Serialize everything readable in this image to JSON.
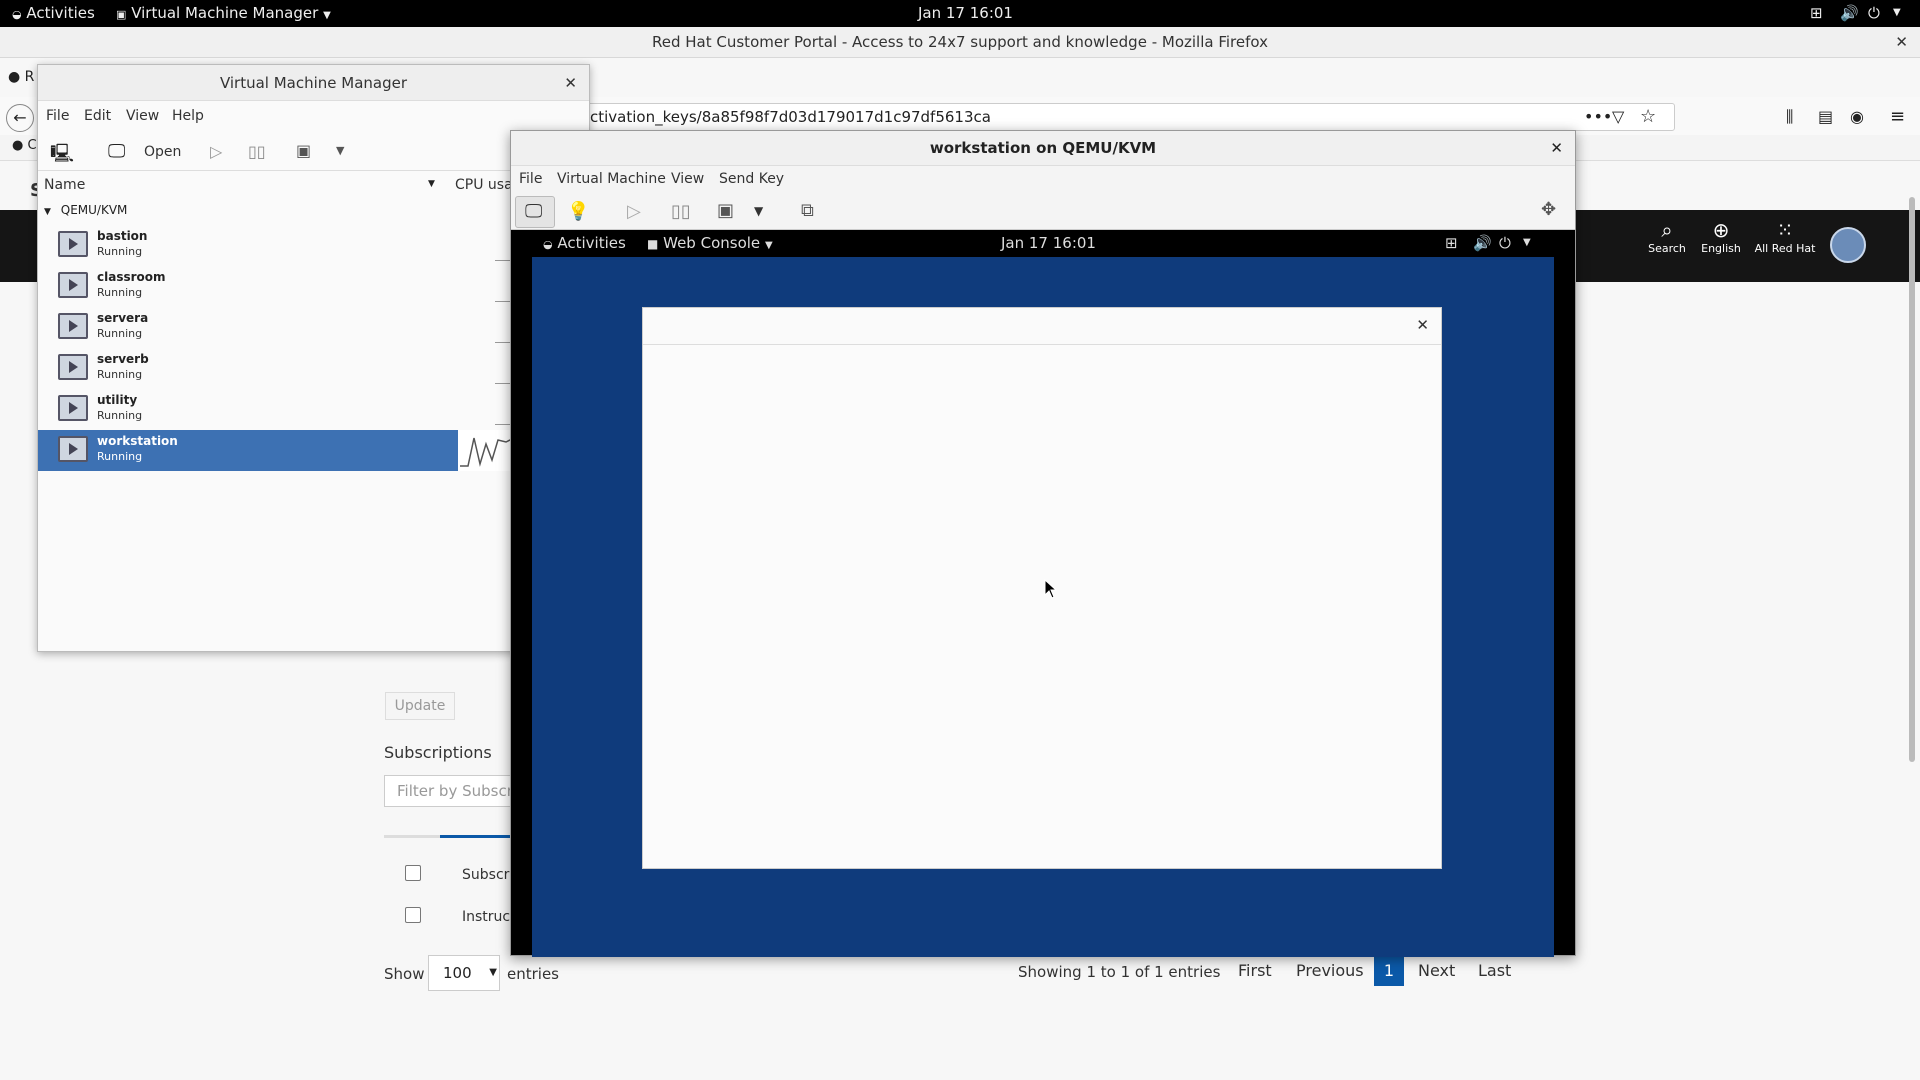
{
  "topbar": {
    "activities": "Activities",
    "app_menu": "Virtual Machine Manager",
    "clock": "Jan 17  16:01"
  },
  "firefox": {
    "title": "Red Hat Customer Portal - Access to 24x7 support and knowledge - Mozilla Firefox",
    "url": "ctivation_keys/8a85f98f7d03d179017d1c97df5613ca",
    "tab_stub": "R",
    "bookmark_stub": "C",
    "header": {
      "search": "Search",
      "language": "English",
      "all_red_hat": "All Red Hat"
    },
    "page": {
      "heading_stub": "S",
      "update_button": "Update",
      "subscriptions_heading": "Subscriptions",
      "filter_placeholder": "Filter by Subscri",
      "rows": [
        "Subscri",
        "Instruct"
      ],
      "show_label": "Show",
      "page_size": "100",
      "entries_label": "entries",
      "showing_text": "Showing 1 to 1 of 1 entries",
      "pagination": {
        "first": "First",
        "previous": "Previous",
        "current": "1",
        "next": "Next",
        "last": "Last"
      }
    }
  },
  "vmm": {
    "title": "Virtual Machine Manager",
    "menu": [
      "File",
      "Edit",
      "View",
      "Help"
    ],
    "toolbar": {
      "open": "Open"
    },
    "columns": {
      "name": "Name",
      "cpu": "CPU usa"
    },
    "connection": "QEMU/KVM",
    "vms": [
      {
        "name": "bastion",
        "status": "Running"
      },
      {
        "name": "classroom",
        "status": "Running"
      },
      {
        "name": "servera",
        "status": "Running"
      },
      {
        "name": "serverb",
        "status": "Running"
      },
      {
        "name": "utility",
        "status": "Running"
      },
      {
        "name": "workstation",
        "status": "Running"
      }
    ],
    "selected_vm": "workstation"
  },
  "viewer": {
    "title": "workstation on QEMU/KVM",
    "menu": [
      "File",
      "Virtual Machine",
      "View",
      "Send Key"
    ],
    "guest": {
      "activities": "Activities",
      "app_menu": "Web Console",
      "clock": "Jan 17  16:01"
    }
  },
  "colors": {
    "guest_desktop": "#0f3b7c",
    "selection": "#3d71b3",
    "rh_header": "#151515",
    "pagination_active": "#0b59a8"
  }
}
